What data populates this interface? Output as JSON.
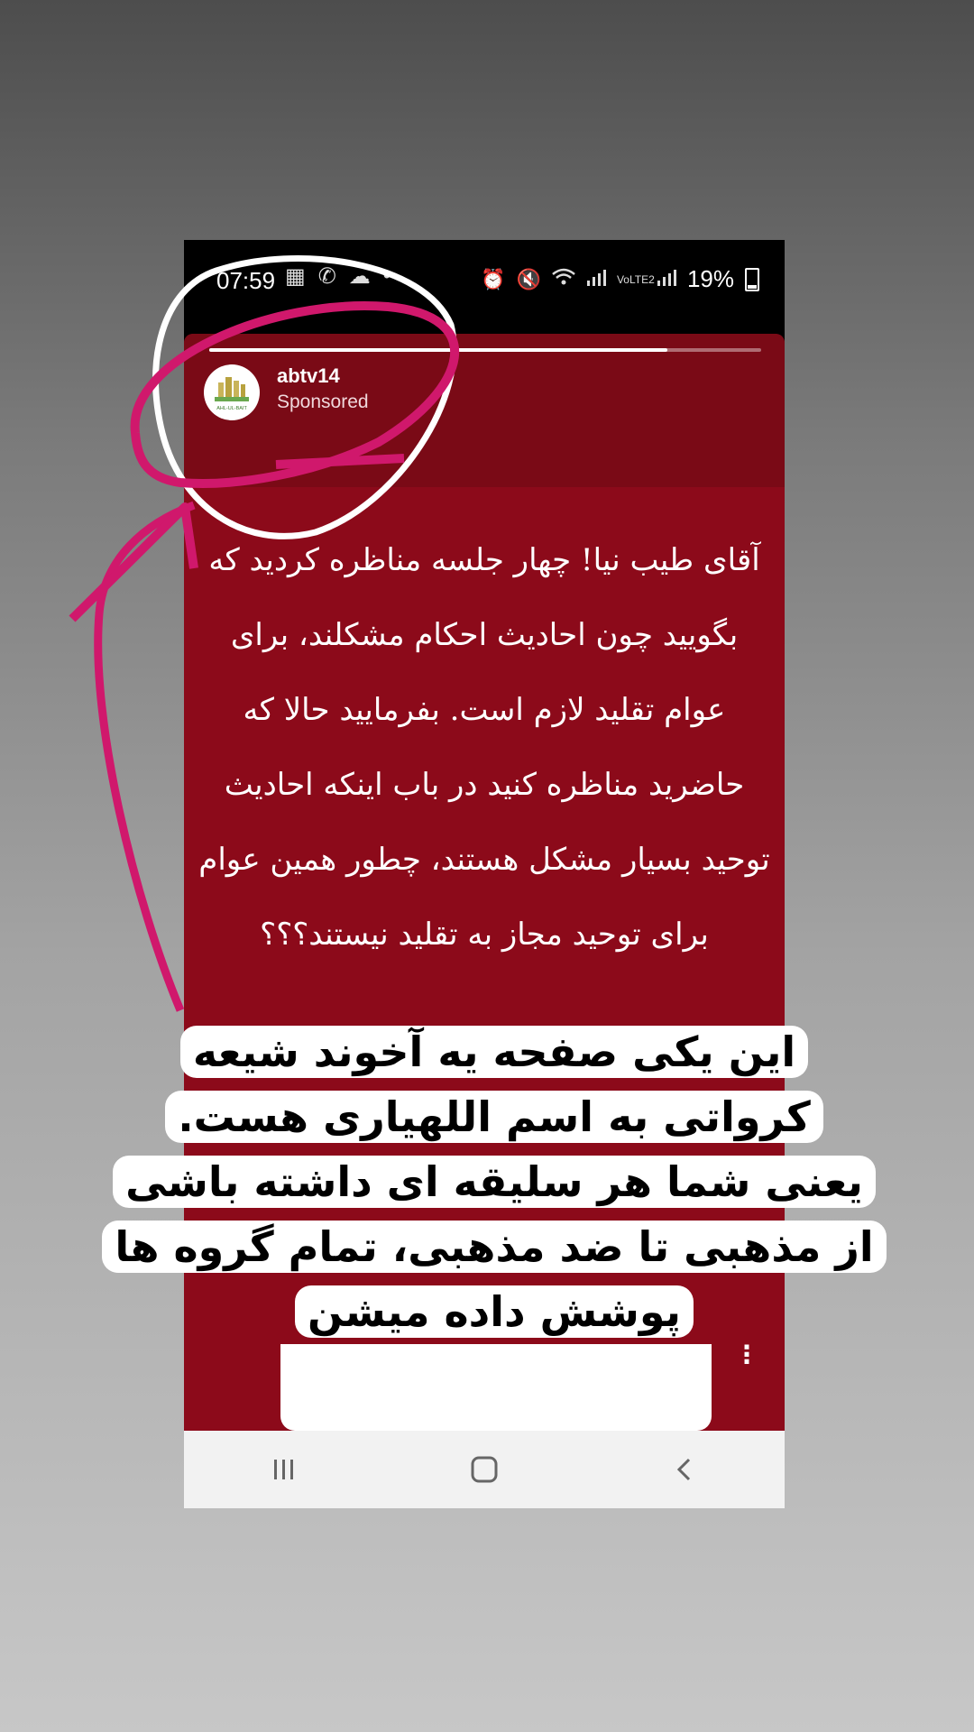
{
  "status_bar": {
    "time": "07:59",
    "battery": "19%",
    "network_label": "VoLTE2",
    "left_icons": [
      "calendar-icon",
      "call-icon",
      "cloud-icon",
      "dot-icon"
    ],
    "right_icons": [
      "alarm-icon",
      "mute-icon",
      "wifi-icon",
      "signal-icon",
      "lte-icon",
      "battery-icon"
    ]
  },
  "story": {
    "progress": 0.83,
    "account": "abtv14",
    "sponsored": "Sponsored",
    "avatar_text": "AHL-UL-BAIT",
    "text_lines": [
      "آقای طیب نیا! چهار جلسه مناظره کردید که",
      "بگویید چون احادیث احکام مشکلند، برای",
      "عوام تقلید لازم است. بفرمایید حالا که",
      "حاضرید مناظره کنید در باب اینکه احادیث",
      "توحید بسیار مشکل هستند، چطور همین عوام",
      "برای توحید مجاز به تقلید نیستند؟؟؟"
    ],
    "more_icon": "more-vertical-icon",
    "background_color": "#8c0a1a"
  },
  "caption": {
    "lines": [
      "این یکی صفحه یه آخوند شیعه",
      "کرواتی به اسم اللهیاری هست.",
      "یعنی شما هر سلیقه ای داشته باشی",
      "از مذهبی تا ضد مذهبی، تمام گروه ها",
      "پوشش داده میشن"
    ]
  },
  "nav_bar": {
    "buttons": [
      "recent-apps-icon",
      "home-icon",
      "back-icon"
    ]
  },
  "annotation_colors": {
    "pink": "#d0186c",
    "white": "#ffffff"
  }
}
